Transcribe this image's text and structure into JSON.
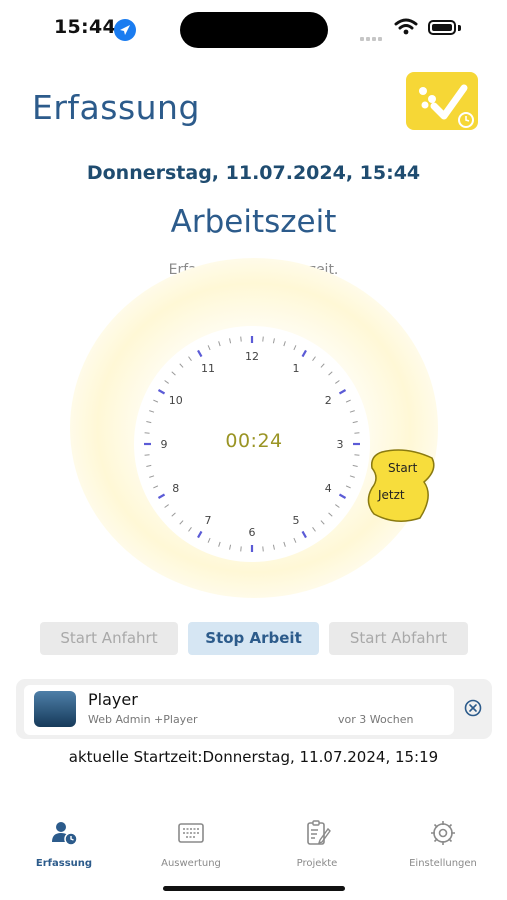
{
  "status_bar": {
    "time": "15:44"
  },
  "header": {
    "title": "Erfassung",
    "logo_icon": "checkmark-clock-logo"
  },
  "date_time": "Donnerstag, 11.07.2024, 15:44",
  "section": {
    "title": "Arbeitszeit",
    "subtitle": "Erfasse dein Arbeitszeit."
  },
  "clock": {
    "numbers": [
      "12",
      "1",
      "2",
      "3",
      "4",
      "5",
      "6",
      "7",
      "8",
      "9",
      "10",
      "11"
    ],
    "elapsed": "00:24",
    "start_button": {
      "label": "Start",
      "sub_label": "Jetzt"
    }
  },
  "actions": {
    "start_anfahrt": "Start Anfahrt",
    "stop_arbeit": "Stop Arbeit",
    "start_abfahrt": "Start Abfahrt"
  },
  "project_card": {
    "title": "Player",
    "subtitle": "Web Admin +Player",
    "time": "vor 3 Wochen"
  },
  "current_start": "aktuelle Startzeit:Donnerstag, 11.07.2024, 15:19",
  "tabs": [
    {
      "label": "Erfassung",
      "icon": "person-clock-icon",
      "active": true
    },
    {
      "label": "Auswertung",
      "icon": "keyboard-icon",
      "active": false
    },
    {
      "label": "Projekte",
      "icon": "clipboard-edit-icon",
      "active": false
    },
    {
      "label": "Einstellungen",
      "icon": "gear-icon",
      "active": false
    }
  ],
  "colors": {
    "primary": "#2c5b8b",
    "accent_yellow": "#f6d736",
    "tick_blue": "#5b5bd6",
    "timer_text": "#9a9424"
  }
}
